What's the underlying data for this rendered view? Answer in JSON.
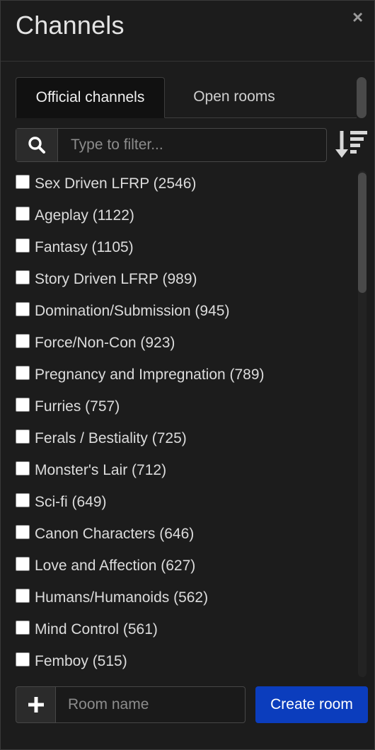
{
  "dialog": {
    "title": "Channels",
    "close_icon": "close-icon",
    "close_glyph": "×"
  },
  "tabs": [
    {
      "label": "Official channels",
      "active": true
    },
    {
      "label": "Open rooms",
      "active": false
    }
  ],
  "filter": {
    "placeholder": "Type to filter...",
    "value": "",
    "search_icon": "search-icon",
    "sort_icon": "sort-amount-down-icon"
  },
  "channels": [
    {
      "label": "Sex Driven LFRP (2546)",
      "checked": false
    },
    {
      "label": "Ageplay (1122)",
      "checked": false
    },
    {
      "label": "Fantasy (1105)",
      "checked": false
    },
    {
      "label": "Story Driven LFRP (989)",
      "checked": false
    },
    {
      "label": "Domination/Submission (945)",
      "checked": false
    },
    {
      "label": "Force/Non-Con (923)",
      "checked": false
    },
    {
      "label": "Pregnancy and Impregnation (789)",
      "checked": false
    },
    {
      "label": "Furries (757)",
      "checked": false
    },
    {
      "label": "Ferals / Bestiality (725)",
      "checked": false
    },
    {
      "label": "Monster's Lair (712)",
      "checked": false
    },
    {
      "label": "Sci-fi (649)",
      "checked": false
    },
    {
      "label": "Canon Characters (646)",
      "checked": false
    },
    {
      "label": "Love and Affection (627)",
      "checked": false
    },
    {
      "label": "Humans/Humanoids (562)",
      "checked": false
    },
    {
      "label": "Mind Control (561)",
      "checked": false
    },
    {
      "label": "Femboy (515)",
      "checked": false
    }
  ],
  "create": {
    "plus_icon": "plus-icon",
    "room_placeholder": "Room name",
    "room_value": "",
    "button_label": "Create room",
    "accent_color": "#0b3dbd"
  }
}
